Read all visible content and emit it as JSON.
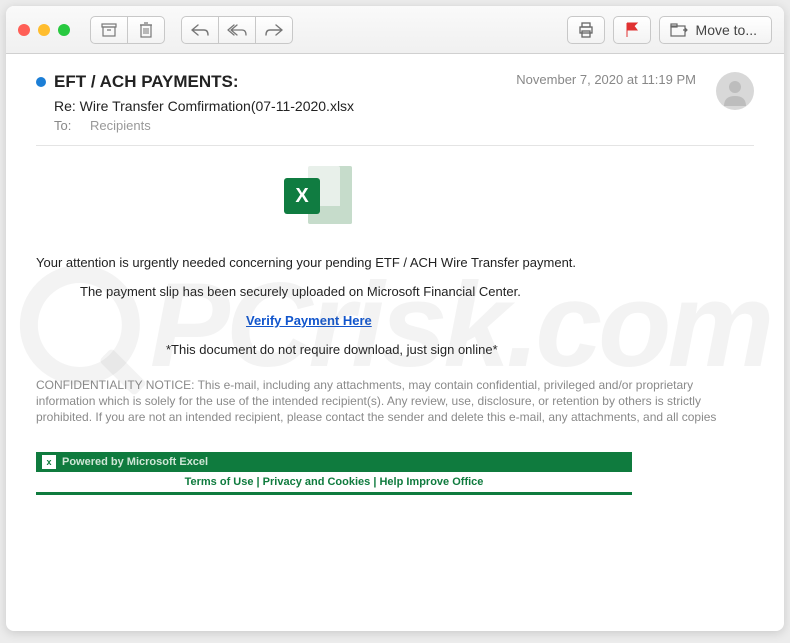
{
  "toolbar": {
    "move_to_label": "Move to..."
  },
  "header": {
    "from": "EFT / ACH PAYMENTS:",
    "date": "November 7, 2020 at 11:19 PM",
    "subject": "Re: Wire Transfer Comfirmation(07-11-2020.xlsx",
    "to_label": "To:",
    "to_value": "Recipients"
  },
  "body": {
    "line1": "Your attention is urgently needed concerning your pending ETF / ACH Wire Transfer payment.",
    "line2": "The payment slip has been securely uploaded on Microsoft Financial Center.",
    "verify_link": "Verify Payment Here",
    "line4": "*This document do not require download, just sign online*",
    "confidentiality": "CONFIDENTIALITY NOTICE: This e-mail, including any attachments, may contain confidential, privileged and/or proprietary information which is solely for the use of the intended recipient(s). Any review, use, disclosure, or retention by others is strictly prohibited. If you are not an intended recipient, please contact the sender and delete this e-mail, any attachments, and all copies"
  },
  "footer": {
    "banner_text": "Powered by Microsoft Excel",
    "banner_icon_text": "x",
    "links": {
      "terms": "Terms of Use",
      "privacy": "Privacy and Cookies",
      "help": "Help Improve Office"
    }
  },
  "icons": {
    "excel_letter": "X"
  },
  "watermark": {
    "text": "PCrisk.com"
  }
}
